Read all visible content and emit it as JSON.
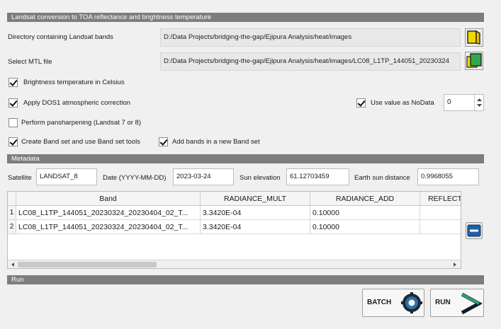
{
  "sections": {
    "main_title": "Landsat conversion to TOA reflectance and brightness temperature",
    "metadata_title": "Metadata",
    "run_title": "Run"
  },
  "directory": {
    "label": "Directory containing Landsat bands",
    "value": "D:/Data Projects/bridging-the-gap/Ejipura Analysis/heat/images"
  },
  "mtl": {
    "label": "Select MTL file",
    "value": "D:/Data Projects/bridging-the-gap/Ejipura Analysis/heat/images/LC08_L1TP_144051_20230324"
  },
  "options": {
    "brightness_celsius": {
      "label": "Brightness temperature in Celsius",
      "checked": true
    },
    "dos1": {
      "label": "Apply DOS1 atmospheric correction",
      "checked": true
    },
    "use_nodata": {
      "label": "Use value as NoData",
      "checked": true
    },
    "nodata_value": "0",
    "pansharpening": {
      "label": "Perform pansharpening (Landsat 7 or 8)",
      "checked": false
    },
    "create_band_set": {
      "label": "Create Band set and use Band set tools",
      "checked": true
    },
    "add_bands": {
      "label": "Add bands in a new Band set",
      "checked": true
    }
  },
  "metadata": {
    "satellite_label": "Satellite",
    "satellite_value": "LANDSAT_8",
    "date_label": "Date (YYYY-MM-DD)",
    "date_value": "2023-03-24",
    "sun_elevation_label": "Sun elevation",
    "sun_elevation_value": "61.12703459",
    "earth_sun_label": "Earth sun distance",
    "earth_sun_value": "0.9968055"
  },
  "table": {
    "headers": [
      "Band",
      "RADIANCE_MULT",
      "RADIANCE_ADD",
      "REFLECT"
    ],
    "rows": [
      {
        "num": "1",
        "band": "LC08_L1TP_144051_20230324_20230404_02_T...",
        "mult": "3.3420E-04",
        "add": "0.10000",
        "reflect": ""
      },
      {
        "num": "2",
        "band": "LC08_L1TP_144051_20230324_20230404_02_T...",
        "mult": "3.3420E-04",
        "add": "0.10000",
        "reflect": ""
      }
    ]
  },
  "buttons": {
    "batch": "BATCH",
    "run": "RUN"
  },
  "colors": {
    "header_bg": "#7d7d7d",
    "folder_yellow": "#f2d600",
    "folder_green": "#2fa84f",
    "remove_blue": "#1f5fa8"
  }
}
